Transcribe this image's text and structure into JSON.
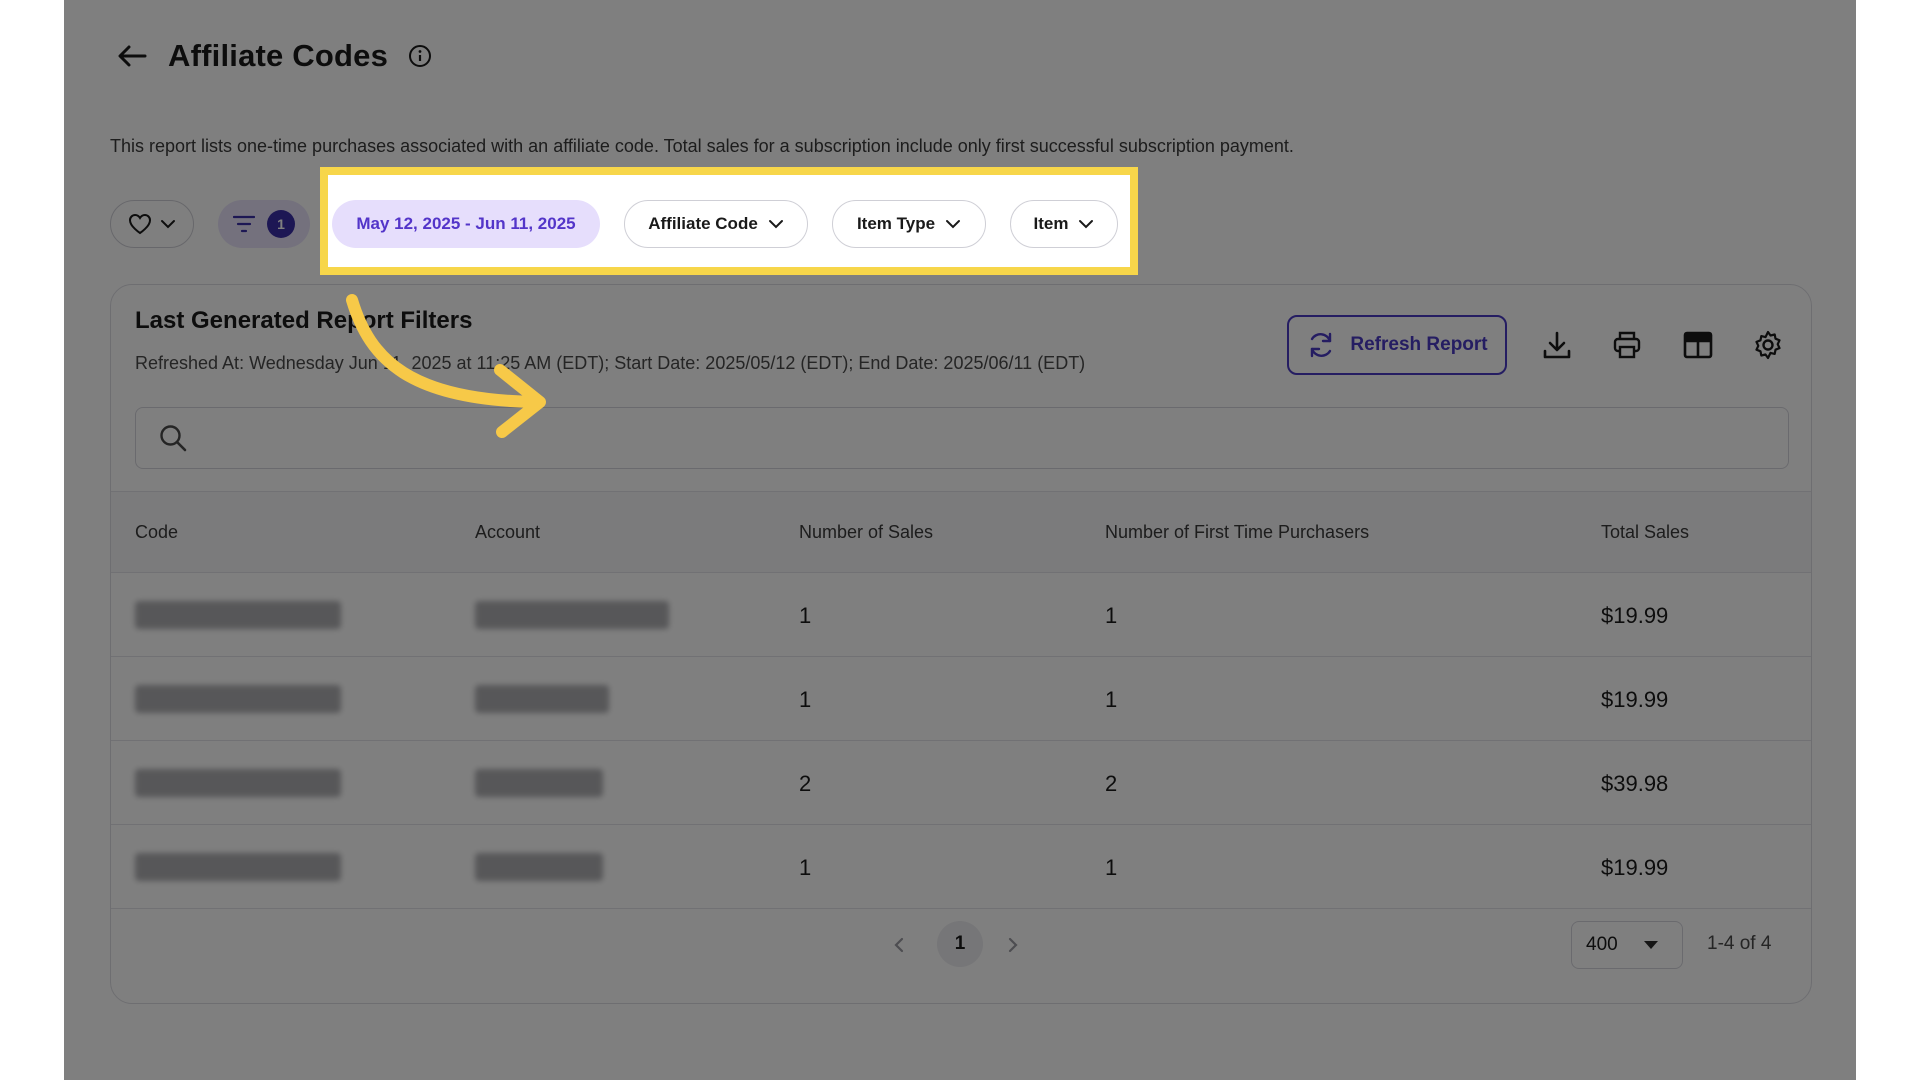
{
  "header": {
    "title": "Affiliate Codes",
    "description": "This report lists one-time purchases associated with an affiliate code. Total sales for a subscription include only first successful subscription payment."
  },
  "filters": {
    "active_count": "1",
    "date_range": "May 12, 2025 - Jun 11, 2025",
    "affiliate_code_label": "Affiliate Code",
    "item_type_label": "Item Type",
    "item_label": "Item"
  },
  "card": {
    "title": "Last Generated Report Filters",
    "subtitle": "Refreshed At: Wednesday Jun 11, 2025 at 11:25 AM (EDT); Start Date: 2025/05/12 (EDT); End Date: 2025/06/11 (EDT)",
    "refresh_label": "Refresh Report",
    "search_placeholder": ""
  },
  "table": {
    "headers": [
      "Code",
      "Account",
      "Number of Sales",
      "Number of First Time Purchasers",
      "Total Sales"
    ],
    "rows": [
      {
        "sales": "1",
        "first_time": "1",
        "total": "$19.99"
      },
      {
        "sales": "1",
        "first_time": "1",
        "total": "$19.99"
      },
      {
        "sales": "2",
        "first_time": "2",
        "total": "$39.98"
      },
      {
        "sales": "1",
        "first_time": "1",
        "total": "$19.99"
      }
    ]
  },
  "pagination": {
    "current_page": "1",
    "per_page": "400",
    "range": "1-4 of 4"
  },
  "colors": {
    "accent": "#4a3bc4",
    "highlight": "#f7d64a",
    "date_pill_bg": "#e6defc"
  },
  "icons": [
    "back-arrow-icon",
    "info-icon",
    "heart-icon",
    "chevron-down-icon",
    "filter-icon",
    "refresh-icon",
    "download-icon",
    "print-icon",
    "table-columns-icon",
    "gear-icon",
    "search-icon",
    "chevron-left-icon",
    "chevron-right-icon",
    "caret-down-icon"
  ]
}
